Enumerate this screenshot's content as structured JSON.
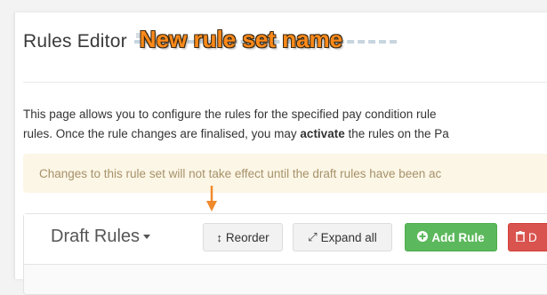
{
  "header": {
    "title": "Rules Editor",
    "rule_set_name_overlay": "New rule set name"
  },
  "description": {
    "line1": "This page allows you to configure the rules for the specified pay condition rule",
    "line2_before": "rules. Once the rule changes are finalised, you may ",
    "line2_bold": "activate",
    "line2_after": " the rules on the Pa"
  },
  "alert": {
    "text": "Changes to this rule set will not take effect until the draft rules have been ac"
  },
  "panel": {
    "title": "Draft Rules",
    "buttons": {
      "reorder": "Reorder",
      "expand_all": "Expand all",
      "add_rule": "Add Rule",
      "delete": "D"
    }
  },
  "colors": {
    "success": "#5cb85c",
    "danger": "#d9534f",
    "alert_bg": "#fcf6e6",
    "overlay_orange": "#ff8a1a"
  },
  "icons": {
    "reorder": "vertical-arrows-icon",
    "expand": "expand-diagonal-icon",
    "add": "plus-circle-icon",
    "delete": "trash-icon",
    "dropdown": "caret-down-icon",
    "annotation": "arrow-down-annotation"
  }
}
